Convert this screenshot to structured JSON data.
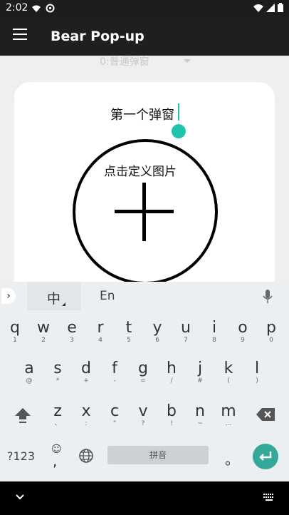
{
  "status": {
    "time": "2:02",
    "left_icons": [
      "wifi-alert-icon",
      "vpn-icon"
    ],
    "right_icons": [
      "wifi-icon",
      "signal-icon",
      "battery-icon"
    ]
  },
  "appbar": {
    "title": "Bear Pop-up",
    "menu_icon": "hamburger-menu-icon"
  },
  "spinner": {
    "value": "0:普通弹窗"
  },
  "editor": {
    "title_text": "第一个弹窗",
    "image_prompt": "点击定义图片"
  },
  "keyboard": {
    "lang_primary": "中",
    "lang_secondary": "En",
    "row1": [
      {
        "m": "q",
        "s": "1"
      },
      {
        "m": "w",
        "s": "2"
      },
      {
        "m": "e",
        "s": "3"
      },
      {
        "m": "r",
        "s": "4"
      },
      {
        "m": "t",
        "s": "5"
      },
      {
        "m": "y",
        "s": "6"
      },
      {
        "m": "u",
        "s": "7"
      },
      {
        "m": "i",
        "s": "8"
      },
      {
        "m": "o",
        "s": "9"
      },
      {
        "m": "p",
        "s": "0"
      }
    ],
    "row2": [
      {
        "m": "a",
        "s": "@"
      },
      {
        "m": "s",
        "s": "*"
      },
      {
        "m": "d",
        "s": "+"
      },
      {
        "m": "f",
        "s": "-"
      },
      {
        "m": "g",
        "s": "="
      },
      {
        "m": "h",
        "s": "/"
      },
      {
        "m": "j",
        "s": "#"
      },
      {
        "m": "k",
        "s": "("
      },
      {
        "m": "l",
        "s": ")"
      }
    ],
    "row3": [
      {
        "m": "z",
        "s": "、"
      },
      {
        "m": "x",
        "s": ":"
      },
      {
        "m": "c",
        "s": "\""
      },
      {
        "m": "v",
        "s": "?"
      },
      {
        "m": "b",
        "s": "!"
      },
      {
        "m": "n",
        "s": "~"
      },
      {
        "m": "m",
        "s": "…"
      }
    ],
    "symbols_label": "?123",
    "emoji_label": "☺",
    "comma_label": ",",
    "space_label": "拼音",
    "period_label": "。"
  },
  "colors": {
    "accent": "#1fc4b0",
    "enter": "#35a999",
    "appbar": "#1f1f1f"
  }
}
